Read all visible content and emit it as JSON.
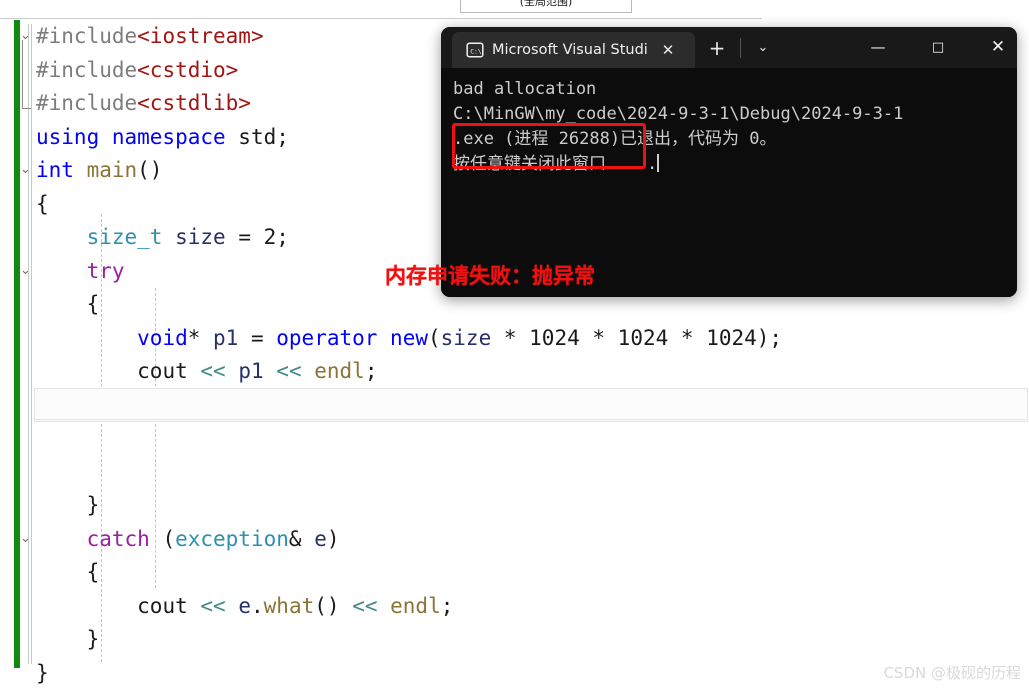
{
  "editor": {
    "scope_dropdown": "(全局范围)",
    "lines": [
      {
        "id": "l1",
        "chevron": "v",
        "tokens": [
          {
            "t": "#include",
            "c": "pp"
          },
          {
            "t": "<iostream>",
            "c": "inc"
          }
        ]
      },
      {
        "id": "l2",
        "chevron": "",
        "tokens": [
          {
            "t": "#include",
            "c": "pp"
          },
          {
            "t": "<cstdio>",
            "c": "inc"
          }
        ]
      },
      {
        "id": "l3",
        "chevron": "",
        "tokens": [
          {
            "t": "#include",
            "c": "pp"
          },
          {
            "t": "<cstdlib>",
            "c": "inc"
          }
        ]
      },
      {
        "id": "l4",
        "chevron": "",
        "tokens": [
          {
            "t": "using namespace ",
            "c": "kw"
          },
          {
            "t": "std;",
            "c": "plain"
          }
        ]
      },
      {
        "id": "l5",
        "chevron": "v",
        "tokens": [
          {
            "t": "int ",
            "c": "kw"
          },
          {
            "t": "main",
            "c": "fn"
          },
          {
            "t": "()",
            "c": "plain"
          }
        ]
      },
      {
        "id": "l6",
        "chevron": "",
        "tokens": [
          {
            "t": "{",
            "c": "plain"
          }
        ]
      },
      {
        "id": "l7",
        "chevron": "",
        "tokens": [
          {
            "t": "    ",
            "c": "plain"
          },
          {
            "t": "size_t",
            "c": "type"
          },
          {
            "t": " ",
            "c": "plain"
          },
          {
            "t": "size",
            "c": "var"
          },
          {
            "t": " = ",
            "c": "plain"
          },
          {
            "t": "2",
            "c": "num"
          },
          {
            "t": ";",
            "c": "plain"
          }
        ]
      },
      {
        "id": "l8",
        "chevron": "v",
        "tokens": [
          {
            "t": "    ",
            "c": "plain"
          },
          {
            "t": "try",
            "c": "kw2"
          }
        ]
      },
      {
        "id": "l9",
        "chevron": "",
        "tokens": [
          {
            "t": "    {",
            "c": "plain"
          }
        ]
      },
      {
        "id": "l10",
        "chevron": "",
        "tokens": [
          {
            "t": "        ",
            "c": "plain"
          },
          {
            "t": "void",
            "c": "kw"
          },
          {
            "t": "* ",
            "c": "plain"
          },
          {
            "t": "p1",
            "c": "var"
          },
          {
            "t": " = ",
            "c": "plain"
          },
          {
            "t": "operator new",
            "c": "kw"
          },
          {
            "t": "(",
            "c": "plain"
          },
          {
            "t": "size",
            "c": "var"
          },
          {
            "t": " * ",
            "c": "plain"
          },
          {
            "t": "1024",
            "c": "num"
          },
          {
            "t": " * ",
            "c": "plain"
          },
          {
            "t": "1024",
            "c": "num"
          },
          {
            "t": " * ",
            "c": "plain"
          },
          {
            "t": "1024",
            "c": "num"
          },
          {
            "t": ");",
            "c": "plain"
          }
        ]
      },
      {
        "id": "l11",
        "chevron": "",
        "tokens": [
          {
            "t": "        ",
            "c": "plain"
          },
          {
            "t": "cout",
            "c": "plain"
          },
          {
            "t": " ",
            "c": "plain"
          },
          {
            "t": "<<",
            "c": "strm"
          },
          {
            "t": " ",
            "c": "plain"
          },
          {
            "t": "p1",
            "c": "var"
          },
          {
            "t": " ",
            "c": "plain"
          },
          {
            "t": "<<",
            "c": "strm"
          },
          {
            "t": " ",
            "c": "plain"
          },
          {
            "t": "endl",
            "c": "fn"
          },
          {
            "t": ";",
            "c": "plain"
          }
        ]
      },
      {
        "id": "l12",
        "chevron": "",
        "tokens": []
      },
      {
        "id": "l13",
        "chevron": "",
        "tokens": []
      },
      {
        "id": "l14",
        "chevron": "",
        "tokens": []
      },
      {
        "id": "l15",
        "chevron": "",
        "tokens": [
          {
            "t": "    }",
            "c": "plain"
          }
        ]
      },
      {
        "id": "l16",
        "chevron": "v",
        "tokens": [
          {
            "t": "    ",
            "c": "plain"
          },
          {
            "t": "catch",
            "c": "kw2"
          },
          {
            "t": " (",
            "c": "plain"
          },
          {
            "t": "exception",
            "c": "type"
          },
          {
            "t": "& ",
            "c": "plain"
          },
          {
            "t": "e",
            "c": "var"
          },
          {
            "t": ")",
            "c": "plain"
          }
        ]
      },
      {
        "id": "l17",
        "chevron": "",
        "tokens": [
          {
            "t": "    {",
            "c": "plain"
          }
        ]
      },
      {
        "id": "l18",
        "chevron": "",
        "tokens": [
          {
            "t": "        ",
            "c": "plain"
          },
          {
            "t": "cout",
            "c": "plain"
          },
          {
            "t": " ",
            "c": "plain"
          },
          {
            "t": "<<",
            "c": "strm"
          },
          {
            "t": " ",
            "c": "plain"
          },
          {
            "t": "e",
            "c": "var"
          },
          {
            "t": ".",
            "c": "plain"
          },
          {
            "t": "what",
            "c": "fn"
          },
          {
            "t": "()",
            "c": "plain"
          },
          {
            "t": " ",
            "c": "plain"
          },
          {
            "t": "<<",
            "c": "strm"
          },
          {
            "t": " ",
            "c": "plain"
          },
          {
            "t": "endl",
            "c": "fn"
          },
          {
            "t": ";",
            "c": "plain"
          }
        ]
      },
      {
        "id": "l19",
        "chevron": "",
        "tokens": [
          {
            "t": "    }",
            "c": "plain"
          }
        ]
      },
      {
        "id": "l20",
        "chevron": "",
        "tokens": [
          {
            "t": "}",
            "c": "plain"
          }
        ]
      }
    ]
  },
  "console": {
    "tab_title": "Microsoft Visual Studi",
    "tab_icon": "console-cmd-icon",
    "tab_close_glyph": "✕",
    "new_tab_glyph": "+",
    "dropdown_glyph": "⌄",
    "minimize_glyph": "—",
    "maximize_glyph": "□",
    "close_glyph": "✕",
    "output_lines": [
      "bad allocation",
      "C:\\MinGW\\my_code\\2024-9-3-1\\Debug\\2024-9-3-1",
      ".exe (进程 26288)已退出，代码为 0。",
      "按任意键关闭此窗口. . ."
    ],
    "highlighted_line": "bad allocation"
  },
  "annotation": {
    "text": "内存申请失败：抛异常",
    "color": "#ee1111"
  },
  "watermark": {
    "text": "CSDN @极砚的历程"
  },
  "colors": {
    "change_bar_green": "#108a10",
    "console_background": "#0c0c0c",
    "console_titlebar": "#191919",
    "tab_background": "#2c2c2c",
    "highlight_red": "#ef1111",
    "preprocessor_gray": "#7d7d7d",
    "include_red": "#a31515",
    "keyword_blue": "#0000ff",
    "control_purple": "#9b1fa0",
    "type_teal": "#2b91af",
    "function_olive": "#8a7437",
    "stream_op_teal": "#3f8a8a"
  }
}
